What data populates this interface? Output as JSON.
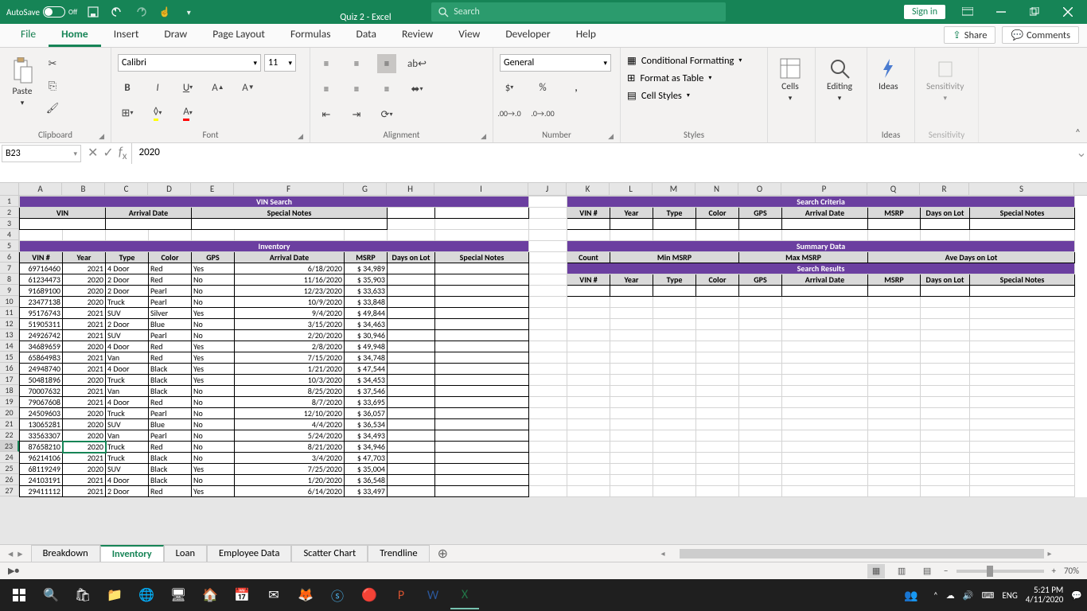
{
  "titleBar": {
    "autosave": "AutoSave",
    "autosave_state": "Off",
    "docTitle": "Quiz 2  -  Excel",
    "searchPlaceholder": "Search",
    "signIn": "Sign in"
  },
  "ribbonTabs": [
    "File",
    "Home",
    "Insert",
    "Draw",
    "Page Layout",
    "Formulas",
    "Data",
    "Review",
    "View",
    "Developer",
    "Help"
  ],
  "shareLabel": "Share",
  "commentsLabel": "Comments",
  "ribbon": {
    "clipboard": {
      "paste": "Paste",
      "label": "Clipboard"
    },
    "font": {
      "name": "Calibri",
      "size": "11",
      "label": "Font"
    },
    "alignment": {
      "label": "Alignment"
    },
    "number": {
      "format": "General",
      "label": "Number"
    },
    "styles": {
      "cond": "Conditional Formatting",
      "table": "Format as Table",
      "cell": "Cell Styles",
      "label": "Styles"
    },
    "cells": {
      "label": "Cells",
      "btn": "Cells"
    },
    "editing": {
      "label": "Editing",
      "btn": "Editing"
    },
    "ideas": {
      "label": "Ideas",
      "btn": "Ideas"
    },
    "sensitivity": {
      "label": "Sensitivity",
      "btn": "Sensitivity"
    }
  },
  "formulaBar": {
    "nameBox": "B23",
    "value": "2020"
  },
  "columns": {
    "letters": [
      "A",
      "B",
      "C",
      "D",
      "E",
      "F",
      "G",
      "H",
      "I",
      "J",
      "K",
      "L",
      "M",
      "N",
      "O",
      "P",
      "Q",
      "R",
      "S"
    ],
    "widths": [
      54,
      54,
      54,
      54,
      54,
      138,
      54,
      60,
      118,
      48,
      54,
      54,
      54,
      54,
      54,
      108,
      66,
      62,
      132
    ]
  },
  "rowCount": 27,
  "selectedRow": 23,
  "vinSearch": {
    "title": "VIN Search",
    "headers": [
      "VIN",
      "Arrival Date",
      "Special Notes"
    ]
  },
  "searchCriteria": {
    "title": "Search Criteria",
    "headers": [
      "VIN #",
      "Year",
      "Type",
      "Color",
      "GPS",
      "Arrival Date",
      "MSRP",
      "Days on Lot",
      "Special Notes"
    ]
  },
  "summaryData": {
    "title": "Summary Data",
    "headers": [
      "Count",
      "Min MSRP",
      "Max MSRP",
      "Ave Days on Lot"
    ]
  },
  "searchResults": {
    "title": "Search Results",
    "headers": [
      "VIN #",
      "Year",
      "Type",
      "Color",
      "GPS",
      "Arrival Date",
      "MSRP",
      "Days on Lot",
      "Special Notes"
    ]
  },
  "inventory": {
    "title": "Inventory",
    "headers": [
      "VIN #",
      "Year",
      "Type",
      "Color",
      "GPS",
      "Arrival Date",
      "MSRP",
      "Days on Lot",
      "Special Notes"
    ],
    "rows": [
      {
        "vin": "69716460",
        "year": "2021",
        "type": "4 Door",
        "color": "Red",
        "gps": "Yes",
        "date": "6/18/2020",
        "msrp": "$  34,989",
        "days": "",
        "notes": ""
      },
      {
        "vin": "61234473",
        "year": "2020",
        "type": "2 Door",
        "color": "Red",
        "gps": "No",
        "date": "11/16/2020",
        "msrp": "$  35,903",
        "days": "",
        "notes": ""
      },
      {
        "vin": "91689100",
        "year": "2020",
        "type": "2 Door",
        "color": "Pearl",
        "gps": "No",
        "date": "12/23/2020",
        "msrp": "$  33,633",
        "days": "",
        "notes": ""
      },
      {
        "vin": "23477138",
        "year": "2020",
        "type": "Truck",
        "color": "Pearl",
        "gps": "No",
        "date": "10/9/2020",
        "msrp": "$  33,848",
        "days": "",
        "notes": ""
      },
      {
        "vin": "95176743",
        "year": "2021",
        "type": "SUV",
        "color": "Silver",
        "gps": "Yes",
        "date": "9/4/2020",
        "msrp": "$  49,844",
        "days": "",
        "notes": ""
      },
      {
        "vin": "51905311",
        "year": "2021",
        "type": "2 Door",
        "color": "Blue",
        "gps": "No",
        "date": "3/15/2020",
        "msrp": "$  34,463",
        "days": "",
        "notes": ""
      },
      {
        "vin": "24926742",
        "year": "2021",
        "type": "SUV",
        "color": "Pearl",
        "gps": "No",
        "date": "2/20/2020",
        "msrp": "$  30,946",
        "days": "",
        "notes": ""
      },
      {
        "vin": "34689659",
        "year": "2020",
        "type": "4 Door",
        "color": "Red",
        "gps": "Yes",
        "date": "2/8/2020",
        "msrp": "$  49,948",
        "days": "",
        "notes": ""
      },
      {
        "vin": "65864983",
        "year": "2021",
        "type": "Van",
        "color": "Red",
        "gps": "Yes",
        "date": "7/15/2020",
        "msrp": "$  34,748",
        "days": "",
        "notes": ""
      },
      {
        "vin": "24948740",
        "year": "2021",
        "type": "4 Door",
        "color": "Black",
        "gps": "Yes",
        "date": "1/21/2020",
        "msrp": "$  47,544",
        "days": "",
        "notes": ""
      },
      {
        "vin": "50481896",
        "year": "2020",
        "type": "Truck",
        "color": "Black",
        "gps": "Yes",
        "date": "10/3/2020",
        "msrp": "$  34,453",
        "days": "",
        "notes": ""
      },
      {
        "vin": "70007632",
        "year": "2021",
        "type": "Van",
        "color": "Black",
        "gps": "No",
        "date": "8/25/2020",
        "msrp": "$  37,546",
        "days": "",
        "notes": ""
      },
      {
        "vin": "79067608",
        "year": "2021",
        "type": "4 Door",
        "color": "Red",
        "gps": "No",
        "date": "8/7/2020",
        "msrp": "$  33,695",
        "days": "",
        "notes": ""
      },
      {
        "vin": "24509603",
        "year": "2020",
        "type": "Truck",
        "color": "Pearl",
        "gps": "No",
        "date": "12/10/2020",
        "msrp": "$  36,057",
        "days": "",
        "notes": ""
      },
      {
        "vin": "13065281",
        "year": "2020",
        "type": "SUV",
        "color": "Blue",
        "gps": "No",
        "date": "4/4/2020",
        "msrp": "$  36,534",
        "days": "",
        "notes": ""
      },
      {
        "vin": "33563307",
        "year": "2020",
        "type": "Van",
        "color": "Pearl",
        "gps": "No",
        "date": "5/24/2020",
        "msrp": "$  34,493",
        "days": "",
        "notes": ""
      },
      {
        "vin": "87658210",
        "year": "2020",
        "type": "Truck",
        "color": "Red",
        "gps": "No",
        "date": "8/21/2020",
        "msrp": "$  34,946",
        "days": "",
        "notes": ""
      },
      {
        "vin": "96214106",
        "year": "2021",
        "type": "Truck",
        "color": "Black",
        "gps": "No",
        "date": "3/4/2020",
        "msrp": "$  47,703",
        "days": "",
        "notes": ""
      },
      {
        "vin": "68119249",
        "year": "2020",
        "type": "SUV",
        "color": "Black",
        "gps": "Yes",
        "date": "7/25/2020",
        "msrp": "$  35,004",
        "days": "",
        "notes": ""
      },
      {
        "vin": "24103191",
        "year": "2021",
        "type": "4 Door",
        "color": "Black",
        "gps": "No",
        "date": "1/20/2020",
        "msrp": "$  36,548",
        "days": "",
        "notes": ""
      },
      {
        "vin": "29411112",
        "year": "2021",
        "type": "2 Door",
        "color": "Red",
        "gps": "Yes",
        "date": "6/14/2020",
        "msrp": "$  33,497",
        "days": "",
        "notes": ""
      }
    ]
  },
  "sheetTabs": [
    "Breakdown",
    "Inventory",
    "Loan",
    "Employee Data",
    "Scatter Chart",
    "Trendline"
  ],
  "activeSheet": 1,
  "statusBar": {
    "zoom": "70%"
  },
  "taskbar": {
    "lang": "ENG",
    "time": "5:21 PM",
    "date": "4/11/2020"
  }
}
